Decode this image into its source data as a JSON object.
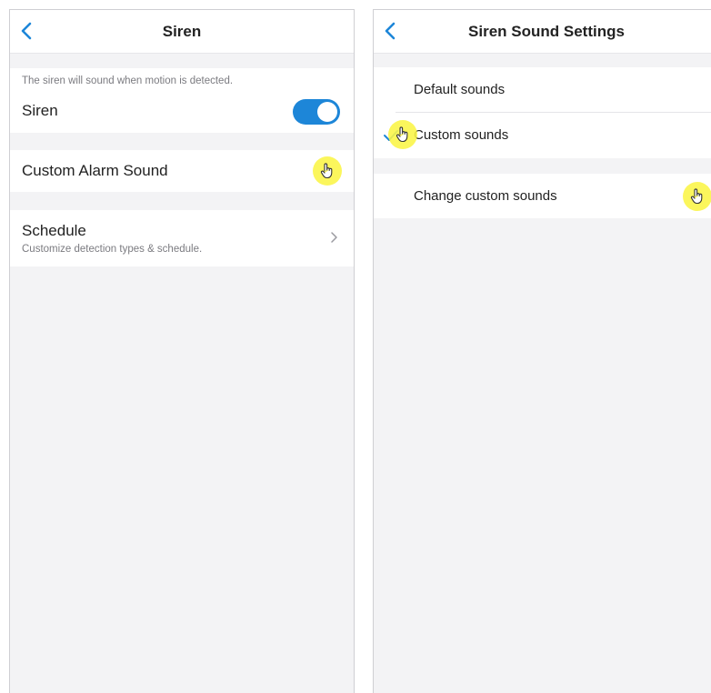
{
  "left": {
    "header": {
      "title": "Siren"
    },
    "siren_section": {
      "caption": "The siren will sound when motion is detected.",
      "label": "Siren",
      "toggle_on": true
    },
    "custom_alarm": {
      "label": "Custom Alarm Sound"
    },
    "schedule": {
      "label": "Schedule",
      "subtitle": "Customize detection types & schedule."
    }
  },
  "right": {
    "header": {
      "title": "Siren Sound Settings"
    },
    "options": [
      {
        "label": "Default sounds",
        "selected": false
      },
      {
        "label": "Custom sounds",
        "selected": true
      }
    ],
    "change_custom": {
      "label": "Change custom sounds"
    }
  },
  "colors": {
    "accent": "#1d86d8",
    "background": "#f3f3f5",
    "highlight": "#faf546"
  },
  "icons": [
    "back-arrow-icon",
    "chevron-right-icon",
    "checkmark-icon",
    "hand-pointer-icon"
  ]
}
